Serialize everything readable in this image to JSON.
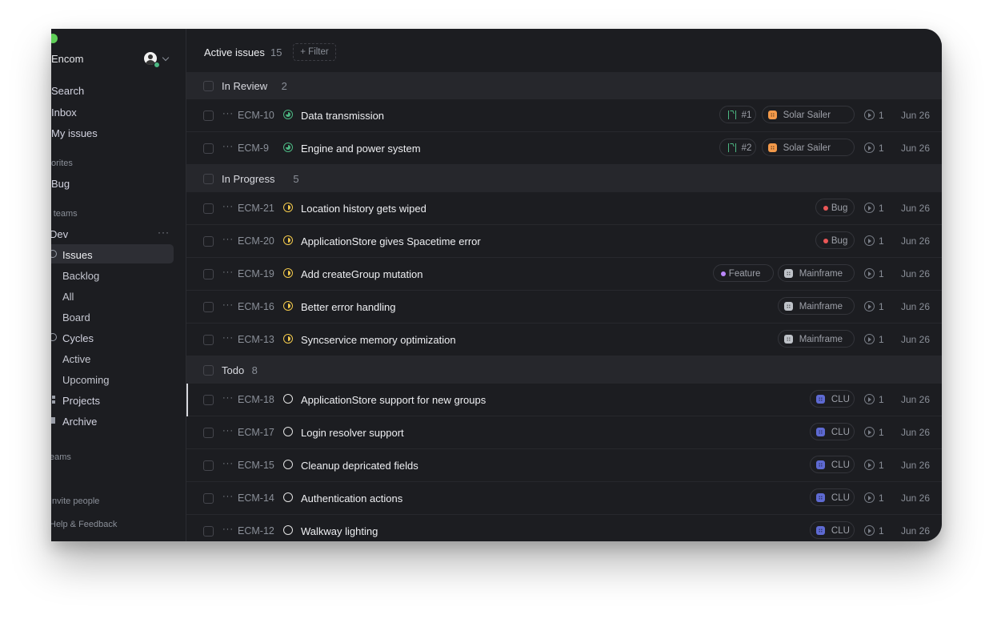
{
  "workspace": {
    "name": "Encom"
  },
  "sidebar": {
    "nav": [
      "Search",
      "Inbox",
      "My issues"
    ],
    "favorites_label": "orites",
    "favorites": [
      "Bug"
    ],
    "teams_label": "r teams",
    "team_name": "Dev",
    "team_items": [
      "Issues",
      "Backlog",
      "All",
      "Board",
      "Cycles",
      "Active",
      "Upcoming",
      "Projects",
      "Archive"
    ],
    "other_teams_label": "eams",
    "invite_label": "Invite people",
    "help_label": "Help & Feedback"
  },
  "header": {
    "title": "Active issues",
    "count": "15",
    "filter_label": "+ Filter"
  },
  "groups": [
    {
      "name": "In Review",
      "count": "2",
      "status": "review",
      "issues": [
        {
          "id": "ECM-10",
          "title": "Data transmission",
          "pr": "#1",
          "project": "Solar Sailer",
          "project_color": "#f2994a",
          "cycle": "1",
          "date": "Jun 26"
        },
        {
          "id": "ECM-9",
          "title": "Engine and power system",
          "pr": "#2",
          "project": "Solar Sailer",
          "project_color": "#f2994a",
          "cycle": "1",
          "date": "Jun 26"
        }
      ]
    },
    {
      "name": "In Progress",
      "count": "5",
      "status": "progress",
      "issues": [
        {
          "id": "ECM-21",
          "title": "Location history gets wiped",
          "label": "Bug",
          "label_color": "#eb5757",
          "cycle": "1",
          "date": "Jun 26"
        },
        {
          "id": "ECM-20",
          "title": "ApplicationStore gives Spacetime error",
          "label": "Bug",
          "label_color": "#eb5757",
          "cycle": "1",
          "date": "Jun 26"
        },
        {
          "id": "ECM-19",
          "title": "Add createGroup mutation",
          "label": "Feature",
          "label_color": "#bb87fc",
          "project": "Mainframe",
          "project_color": "#bec2c8",
          "cycle": "1",
          "date": "Jun 26"
        },
        {
          "id": "ECM-16",
          "title": "Better error handling",
          "project": "Mainframe",
          "project_color": "#bec2c8",
          "cycle": "1",
          "date": "Jun 26"
        },
        {
          "id": "ECM-13",
          "title": "Syncservice memory optimization",
          "project": "Mainframe",
          "project_color": "#bec2c8",
          "cycle": "1",
          "date": "Jun 26"
        }
      ]
    },
    {
      "name": "Todo",
      "count": "8",
      "status": "todo",
      "issues": [
        {
          "id": "ECM-18",
          "title": "ApplicationStore support for new groups",
          "project": "CLU",
          "project_color": "#5e6ad2",
          "cycle": "1",
          "date": "Jun 26",
          "selected": true
        },
        {
          "id": "ECM-17",
          "title": "Login resolver support",
          "project": "CLU",
          "project_color": "#5e6ad2",
          "cycle": "1",
          "date": "Jun 26"
        },
        {
          "id": "ECM-15",
          "title": "Cleanup depricated fields",
          "project": "CLU",
          "project_color": "#5e6ad2",
          "cycle": "1",
          "date": "Jun 26"
        },
        {
          "id": "ECM-14",
          "title": "Authentication actions",
          "project": "CLU",
          "project_color": "#5e6ad2",
          "cycle": "1",
          "date": "Jun 26"
        },
        {
          "id": "ECM-12",
          "title": "Walkway lighting",
          "project": "CLU",
          "project_color": "#5e6ad2",
          "cycle": "1",
          "date": "Jun 26"
        }
      ]
    }
  ]
}
